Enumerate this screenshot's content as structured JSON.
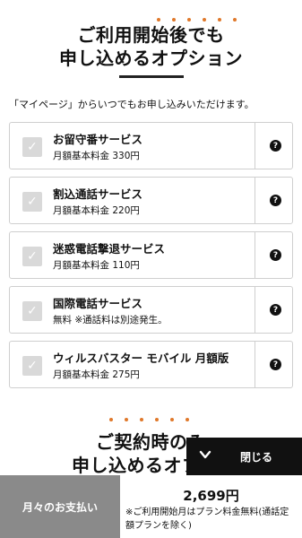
{
  "after_start_section": {
    "title_line1": "ご利用開始後でも",
    "title_line2": "申し込めるオプション",
    "intro": "「マイページ」からいつでもお申し込みいただけます。"
  },
  "options": [
    {
      "name": "お留守番サービス",
      "price": "月額基本料金 330円"
    },
    {
      "name": "割込通話サービス",
      "price": "月額基本料金 220円"
    },
    {
      "name": "迷惑電話撃退サービス",
      "price": "月額基本料金 110円"
    },
    {
      "name": "国際電話サービス",
      "price": "無料 ※通話料は別途発生。"
    },
    {
      "name": "ウィルスバスター モバイル 月額版",
      "price": "月額基本料金 275円"
    }
  ],
  "contract_section": {
    "title_line1": "ご契約時のみ",
    "title_line2": "申し込めるオプ"
  },
  "close_bar": {
    "label": "閉じる"
  },
  "payment": {
    "label": "月々のお支払い",
    "amount": "2,699円",
    "note": "※ご利用開始月はプラン料金無料(通話定額プランを除く)"
  },
  "icons": {
    "check": "check-icon",
    "help": "help-icon",
    "close_chevron": "chevron-down-icon"
  },
  "colors": {
    "accent_dot": "#e0782a",
    "checkbox_disabled": "#d9d9d9",
    "pay_label_bg": "#8a8a8a",
    "close_bar_bg": "#111111"
  }
}
